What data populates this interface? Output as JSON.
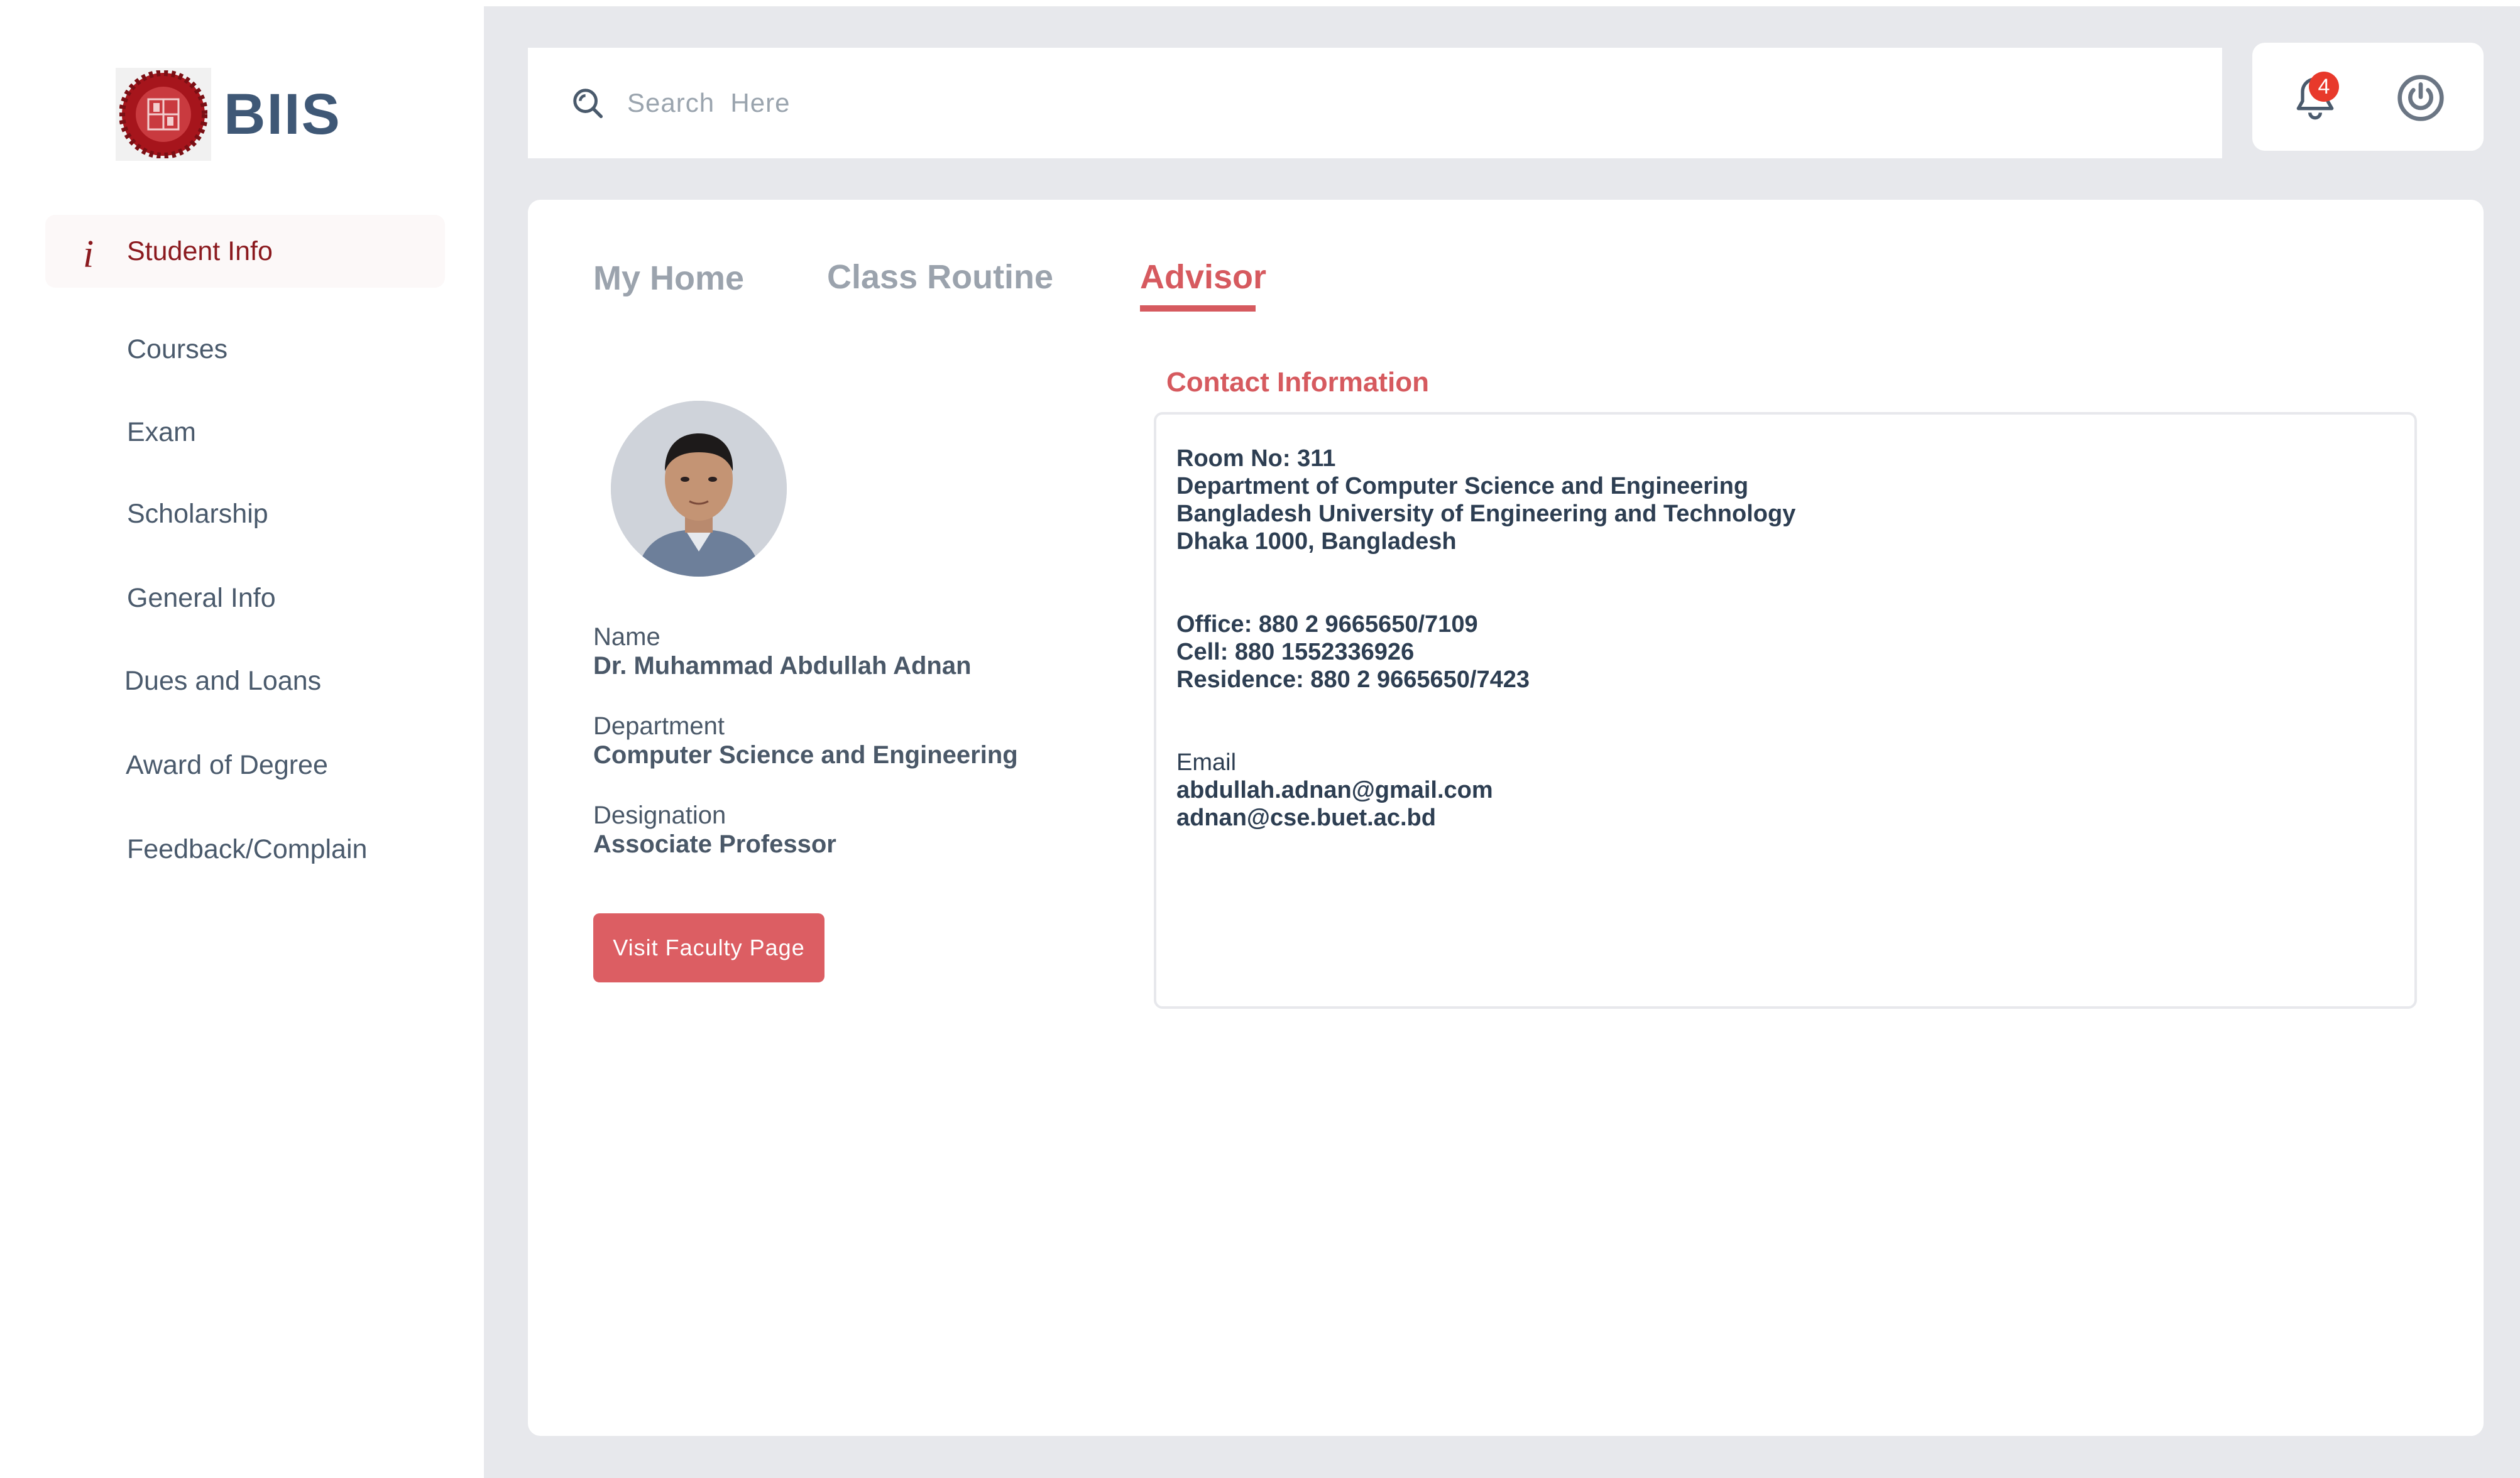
{
  "brand": {
    "name": "BIIS"
  },
  "sidebar": {
    "items": [
      {
        "label": "Student Info",
        "icon": "info-icon",
        "active": true
      },
      {
        "label": "Courses"
      },
      {
        "label": "Exam"
      },
      {
        "label": "Scholarship"
      },
      {
        "label": "General Info"
      },
      {
        "label": "Dues and Loans"
      },
      {
        "label": "Award of Degree"
      },
      {
        "label": "Feedback/Complain"
      }
    ]
  },
  "header": {
    "search_placeholder": "Search  Here",
    "notification_count": "4"
  },
  "tabs": [
    {
      "label": "My Home",
      "active": false
    },
    {
      "label": "Class Routine",
      "active": false
    },
    {
      "label": "Advisor",
      "active": true
    }
  ],
  "advisor": {
    "name_label": "Name",
    "name": "Dr. Muhammad Abdullah Adnan",
    "department_label": "Department",
    "department": "Computer Science and Engineering",
    "designation_label": "Designation",
    "designation": "Associate Professor",
    "visit_button": "Visit Faculty Page"
  },
  "contact": {
    "title": "Contact Information",
    "address": [
      "Room No: 311",
      "Department of Computer Science and Engineering",
      "Bangladesh University of Engineering and Technology",
      "Dhaka 1000, Bangladesh"
    ],
    "phones": [
      "Office: 880 2 9665650/7109",
      "Cell: 880 1552336926",
      "Residence: 880 2 9665650/7423"
    ],
    "email_label": "Email",
    "emails": [
      "abdullah.adnan@gmail.com",
      "adnan@cse.buet.ac.bd"
    ]
  },
  "colors": {
    "accent": "#d65a5f",
    "active_nav": "#8b1a1f",
    "brand_text": "#3f5876",
    "badge": "#e8392b"
  }
}
